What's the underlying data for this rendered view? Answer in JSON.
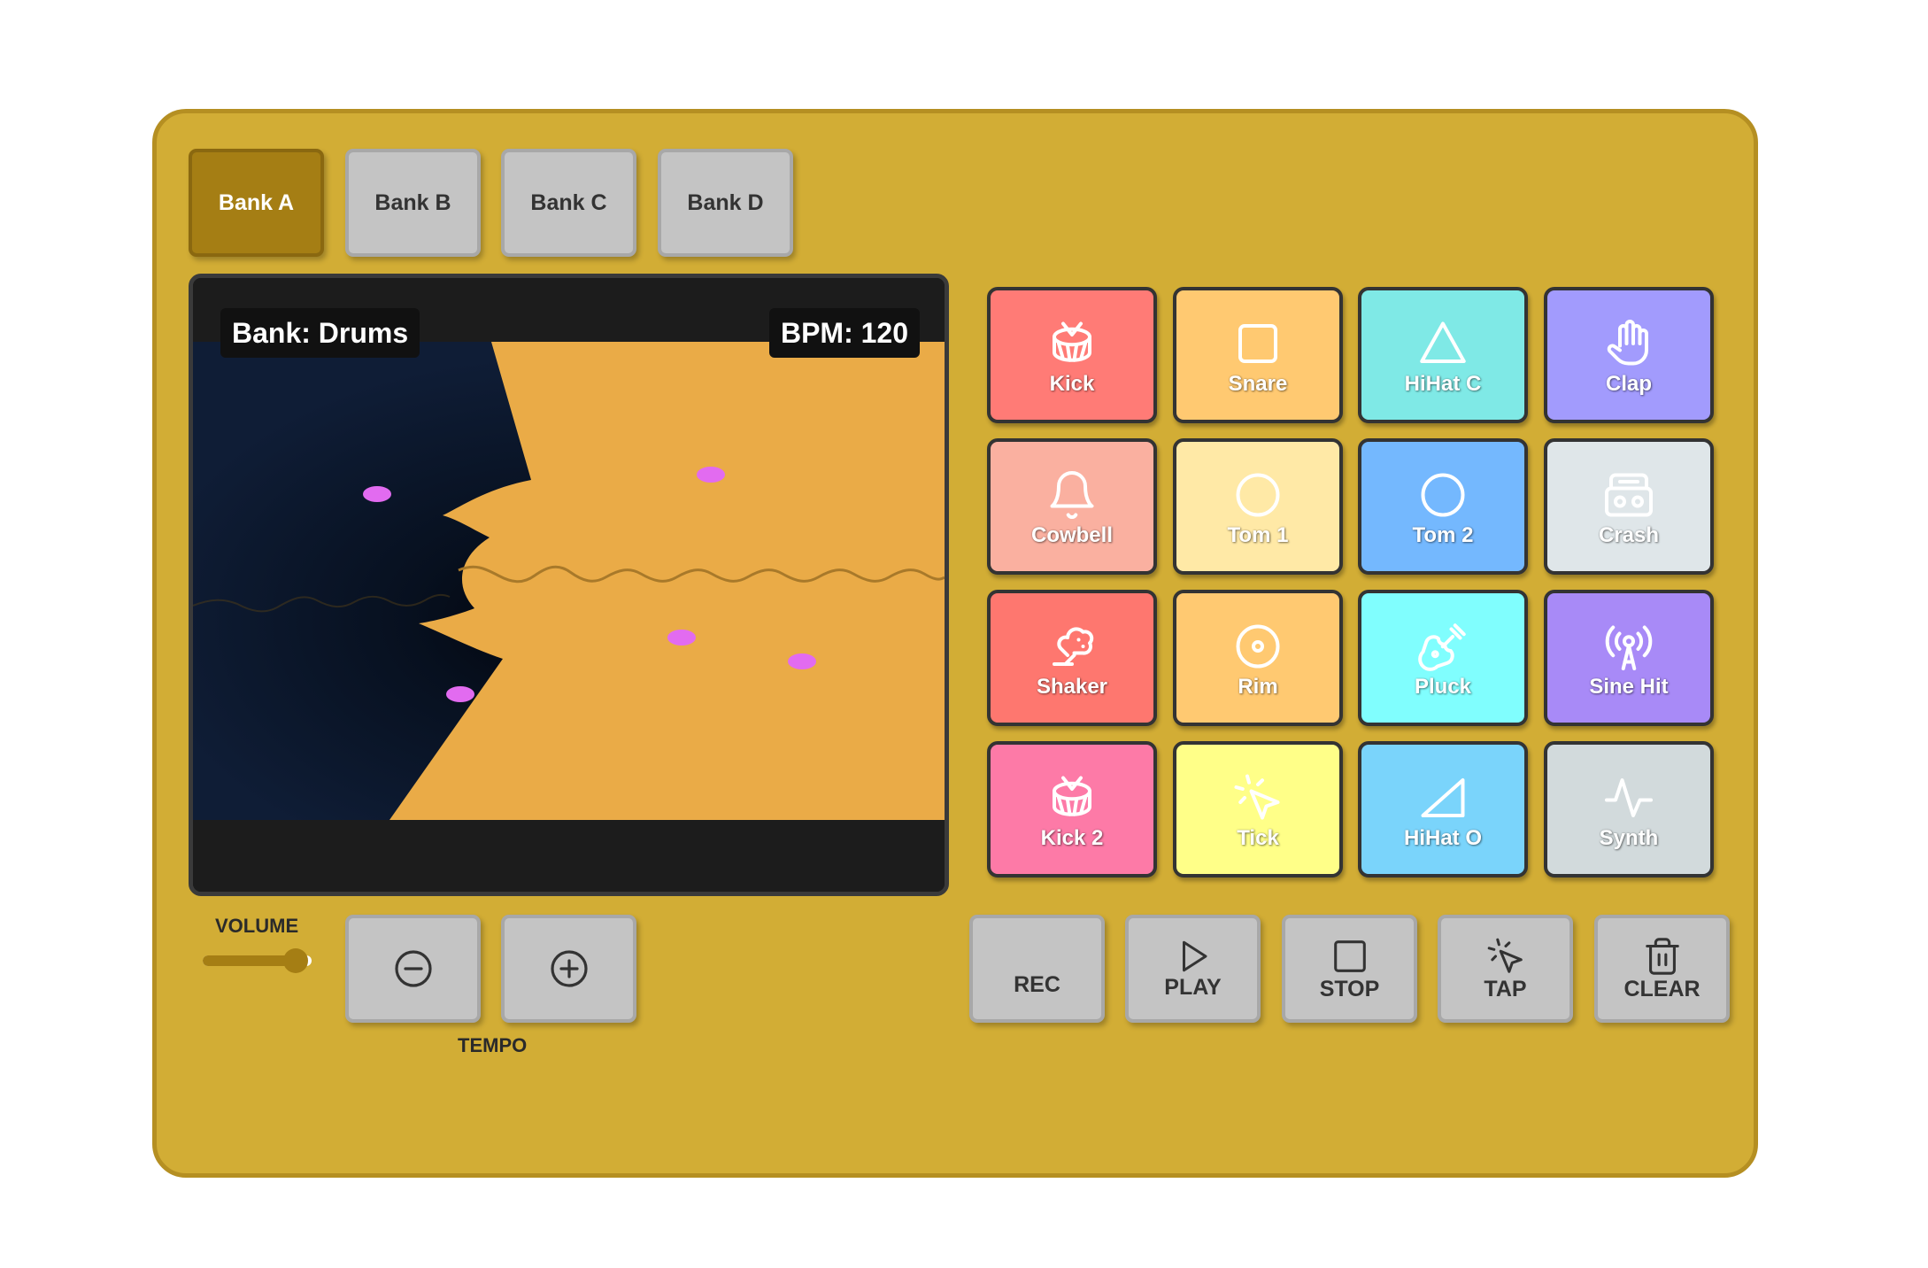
{
  "banks": [
    {
      "label": "Bank A",
      "active": true
    },
    {
      "label": "Bank B",
      "active": false
    },
    {
      "label": "Bank C",
      "active": false
    },
    {
      "label": "Bank D",
      "active": false
    }
  ],
  "display": {
    "bank_text": "Bank: Drums",
    "bpm_text": "BPM: 120"
  },
  "pads": [
    {
      "label": "Kick",
      "icon": "drum-icon",
      "color": "#ff7b76"
    },
    {
      "label": "Snare",
      "icon": "square-icon",
      "color": "#ffc971"
    },
    {
      "label": "HiHat C",
      "icon": "triangle-icon",
      "color": "#7fe9e6"
    },
    {
      "label": "Clap",
      "icon": "hand-icon",
      "color": "#a29bfd"
    },
    {
      "label": "Cowbell",
      "icon": "bell-icon",
      "color": "#fab0a0"
    },
    {
      "label": "Tom 1",
      "icon": "circle-icon",
      "color": "#ffe9a6"
    },
    {
      "label": "Tom 2",
      "icon": "circle-icon",
      "color": "#74b8fe"
    },
    {
      "label": "Crash",
      "icon": "boombox-icon",
      "color": "#dfe6e9"
    },
    {
      "label": "Shaker",
      "icon": "shaker-icon",
      "color": "#fe776f"
    },
    {
      "label": "Rim",
      "icon": "disc-icon",
      "color": "#ffc971"
    },
    {
      "label": "Pluck",
      "icon": "guitar-icon",
      "color": "#80fefe"
    },
    {
      "label": "Sine Hit",
      "icon": "broadcast-icon",
      "color": "#a88af7"
    },
    {
      "label": "Kick 2",
      "icon": "drum-icon",
      "color": "#fd7aa7"
    },
    {
      "label": "Tick",
      "icon": "cursor-click-icon",
      "color": "#ffff88"
    },
    {
      "label": "HiHat O",
      "icon": "ramp-icon",
      "color": "#7ad4fb"
    },
    {
      "label": "Synth",
      "icon": "pulse-icon",
      "color": "#d2dadc"
    }
  ],
  "volume": {
    "label": "VOLUME",
    "level": 0.85
  },
  "tempo": {
    "label": "TEMPO",
    "decrease_icon": "minus-circle-icon",
    "increase_icon": "plus-circle-icon"
  },
  "transport": [
    {
      "label": "REC",
      "icon": ""
    },
    {
      "label": "PLAY",
      "icon": "play-icon"
    },
    {
      "label": "STOP",
      "icon": "stop-icon"
    },
    {
      "label": "TAP",
      "icon": "cursor-click-icon"
    },
    {
      "label": "CLEAR",
      "icon": "trash-icon"
    }
  ]
}
